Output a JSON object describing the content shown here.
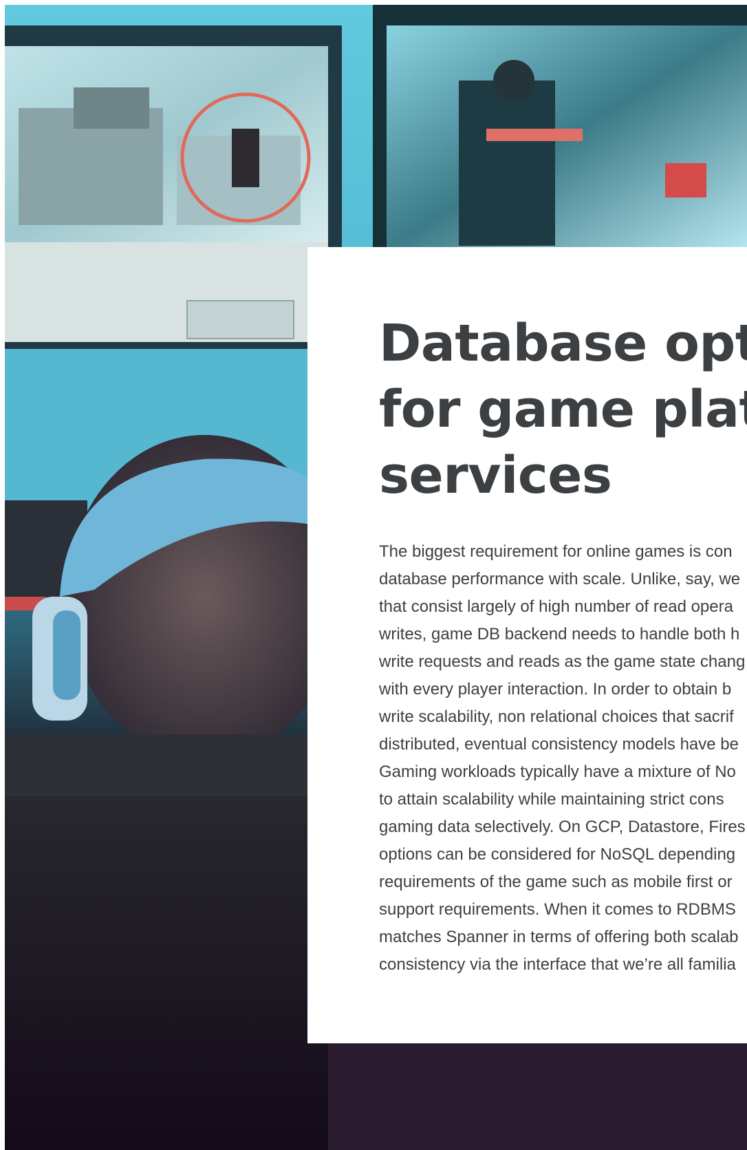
{
  "article": {
    "title": "Database opti\nfor game platf\nservices",
    "body_lines": [
      "The biggest requirement for online games is con",
      "database performance with scale. Unlike, say, we",
      "that consist largely of high number of read opera",
      "writes, game DB backend needs to handle both h",
      "write requests and reads as the game state chang",
      "with every player interaction. In order to obtain b",
      "write scalability, non relational choices that sacrif",
      "distributed, eventual consistency models have be",
      "Gaming workloads typically have a mixture of No",
      "to attain scalability while maintaining strict cons",
      "gaming data selectively. On GCP, Datastore, Fires",
      "options can be considered for NoSQL depending",
      "requirements of the game such as mobile first or",
      "support requirements. When it comes to RDBMS",
      "matches Spanner in terms of offering both scalab",
      "consistency via the interface that we’re all familia"
    ]
  },
  "hero_image": {
    "subject": "gamer-with-headphones-at-monitors",
    "colors": {
      "cyan": "#5fc6dc",
      "dark": "#180b1f",
      "headphones": "#6fb6d8",
      "crosshair": "#e06a5a"
    }
  }
}
